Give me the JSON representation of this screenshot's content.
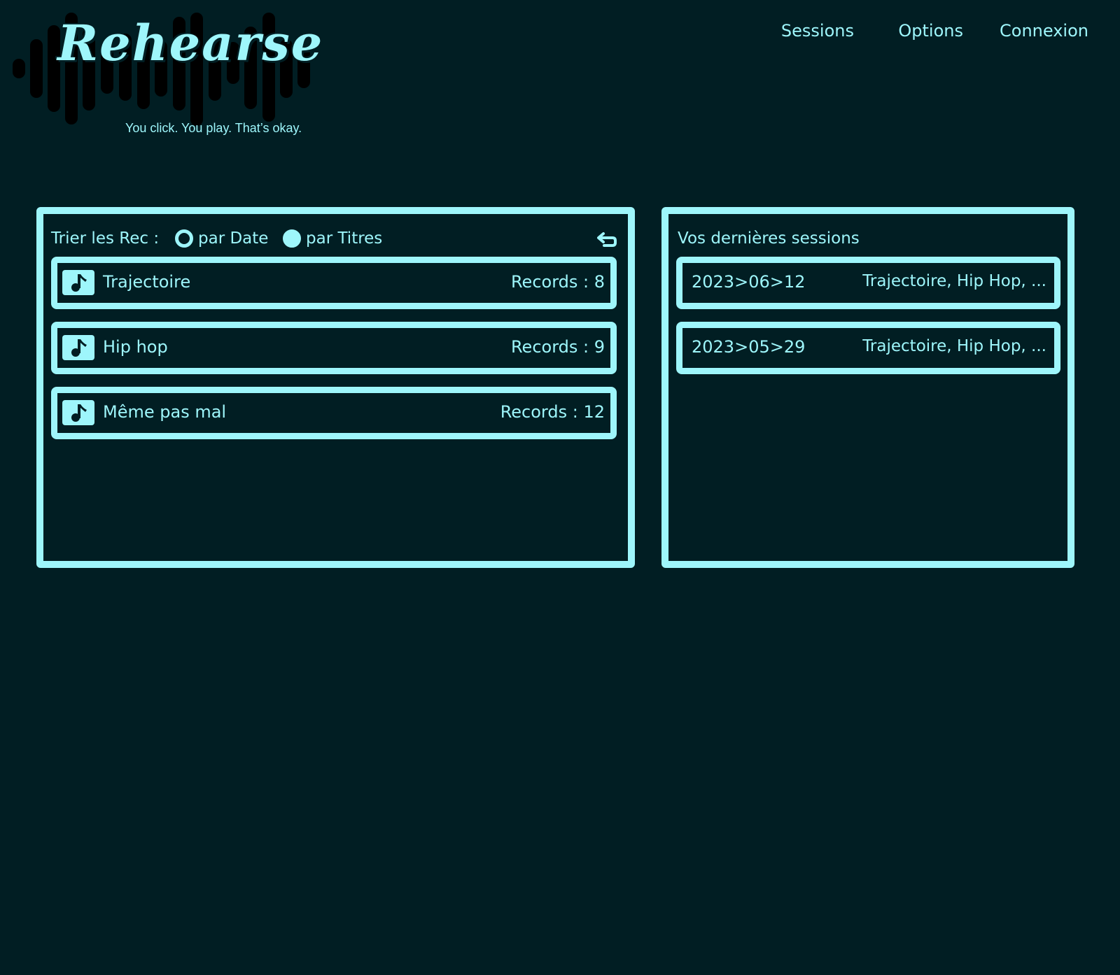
{
  "app": {
    "logo_title": "Rehearse",
    "tagline": "You click. You play. That’s okay."
  },
  "nav": {
    "items": [
      "Sessions",
      "Options",
      "Connexion"
    ]
  },
  "records_panel": {
    "sort_label": "Trier les Rec :",
    "sort_options": [
      {
        "label": "par Date",
        "selected": false
      },
      {
        "label": "par Titres",
        "selected": true
      }
    ],
    "back_icon": "return-arrow-icon",
    "songs": [
      {
        "icon": "music-note-icon",
        "title": "Trajectoire",
        "records": "Records : 8"
      },
      {
        "icon": "music-note-icon",
        "title": "Hip hop",
        "records": "Records : 9"
      },
      {
        "icon": "music-note-icon",
        "title": "Même pas mal",
        "records": "Records : 12"
      }
    ]
  },
  "sessions_panel": {
    "heading": "Vos dernières sessions",
    "sessions": [
      {
        "date": "2023>06>12",
        "tracks": "Trajectoire, Hip Hop, ..."
      },
      {
        "date": "2023>05>29",
        "tracks": "Trajectoire, Hip Hop, ..."
      }
    ]
  },
  "colors": {
    "background": "#011e23",
    "accent": "#9ef6fb"
  }
}
